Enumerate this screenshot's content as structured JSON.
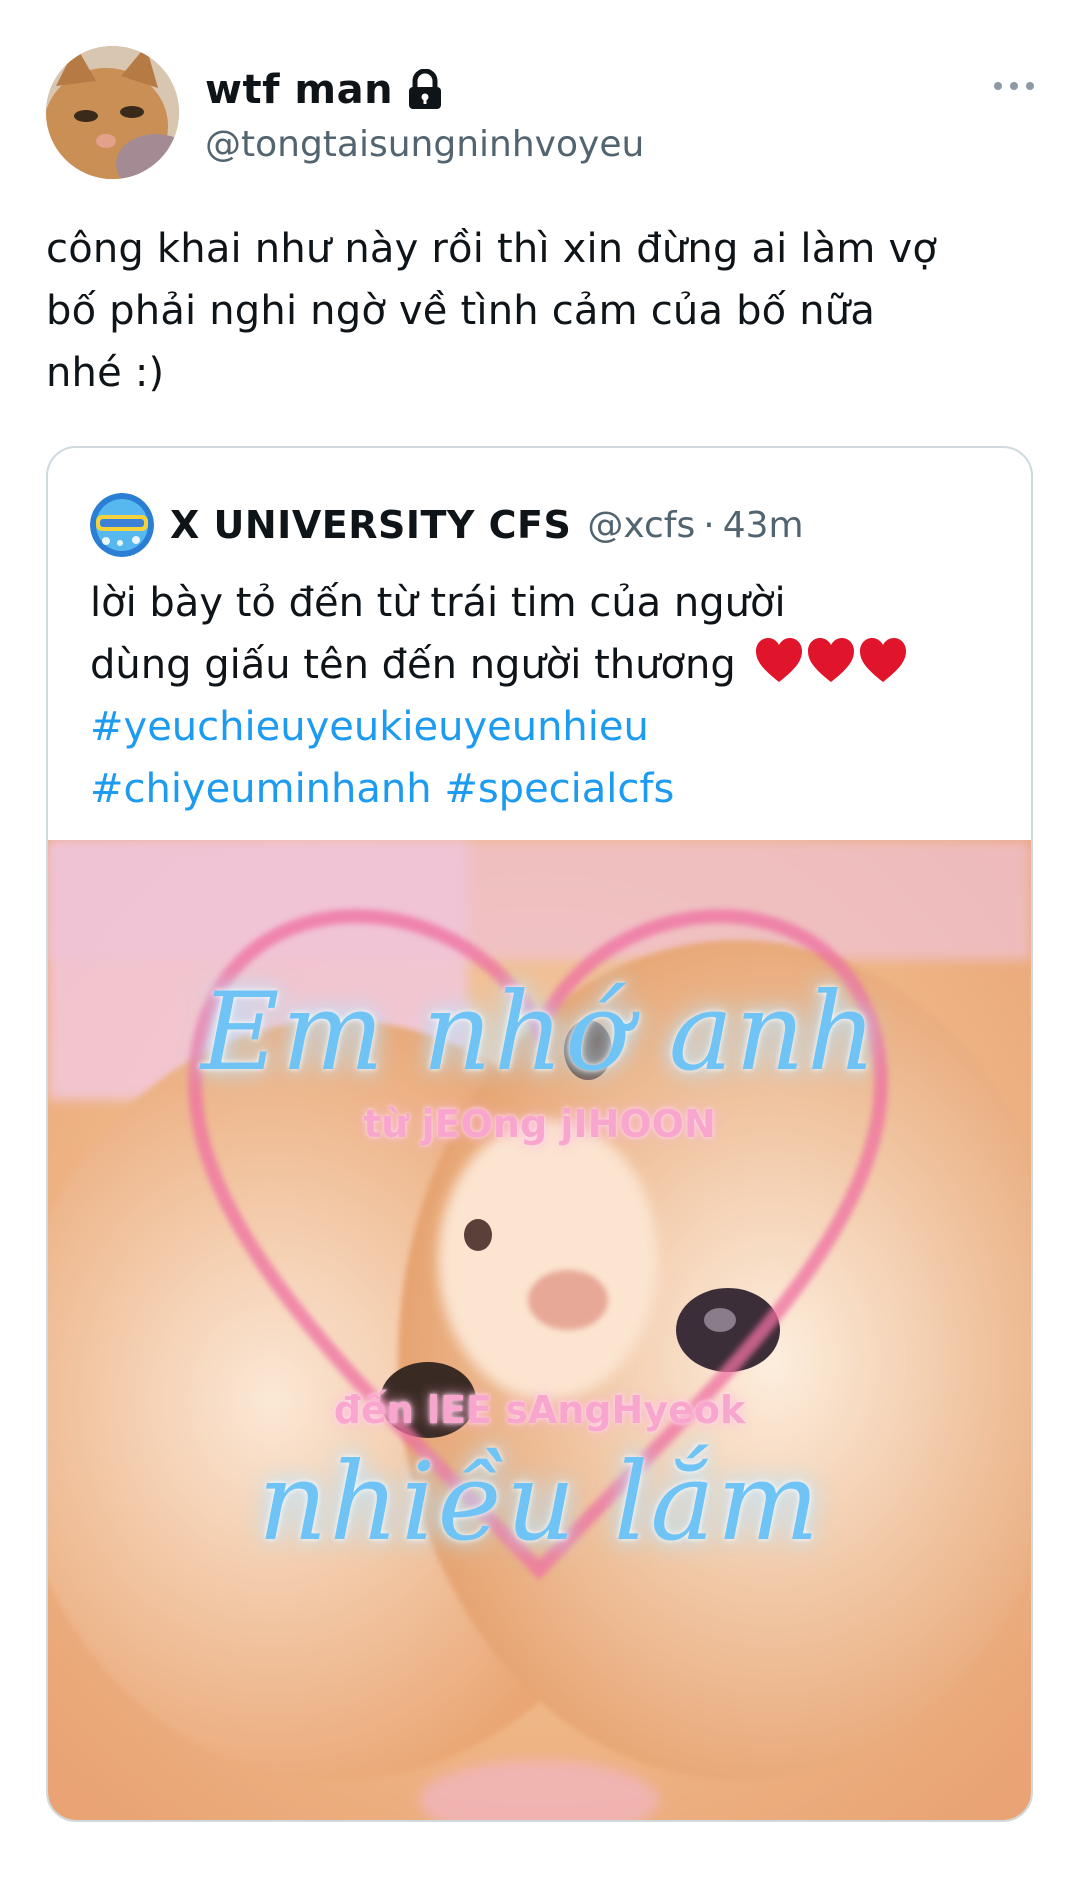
{
  "tweet": {
    "display_name": "wtf man",
    "handle": "@tongtaisungninhvoyeu",
    "text_lines": [
      "công khai như này rồi thì xin đừng ai làm vợ",
      "bố phải nghi ngờ về tình cảm của bố nữa",
      "nhé :)"
    ]
  },
  "quote": {
    "name": "X UNIVERSITY CFS",
    "handle": "@xcfs",
    "separator": "·",
    "time": "43m",
    "line1": "lời bày tỏ đến từ trái tim của người",
    "line2": "dùng giấu tên đến người thương",
    "hearts_icon": "red-heart-emoji",
    "hashtags": [
      "#yeuchieuyeukieuyeunhieu",
      "#chiyeuminhanh",
      "#specialcfs"
    ],
    "image_text": {
      "line_top": "Em nhớ anh",
      "line_from": "từ jEOng jIHOON",
      "line_to": "đến lEE sAngHyeok",
      "line_bottom": "nhiều lắm"
    }
  },
  "icons": {
    "lock": "lock-icon",
    "more": "more-horizontal-icon"
  },
  "colors": {
    "text": "#0f1419",
    "secondary": "#536471",
    "link": "#1d9bf0",
    "border": "#cfd9de",
    "image_title": "#6fc3f5",
    "image_subtitle": "#f9a6cf"
  }
}
